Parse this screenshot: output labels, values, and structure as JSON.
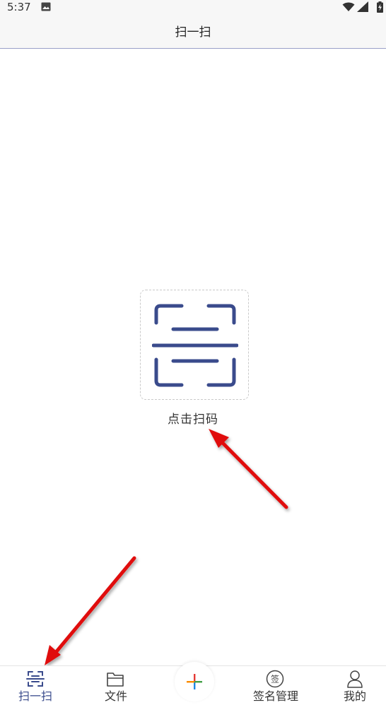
{
  "status_bar": {
    "time": "5:37"
  },
  "header": {
    "title": "扫一扫"
  },
  "scan": {
    "label": "点击扫码"
  },
  "bottom_nav": {
    "items": [
      {
        "label": "扫一扫",
        "icon": "scan-icon",
        "active": true
      },
      {
        "label": "文件",
        "icon": "folder-icon",
        "active": false
      },
      {
        "label": "",
        "icon": "add-icon",
        "active": false
      },
      {
        "label": "签名管理",
        "icon": "signature-icon",
        "active": false
      },
      {
        "label": "我的",
        "icon": "user-icon",
        "active": false
      }
    ]
  },
  "signature_icon_text": "签",
  "colors": {
    "accent": "#3a4b8c",
    "annotation_arrow": "#e01010"
  }
}
